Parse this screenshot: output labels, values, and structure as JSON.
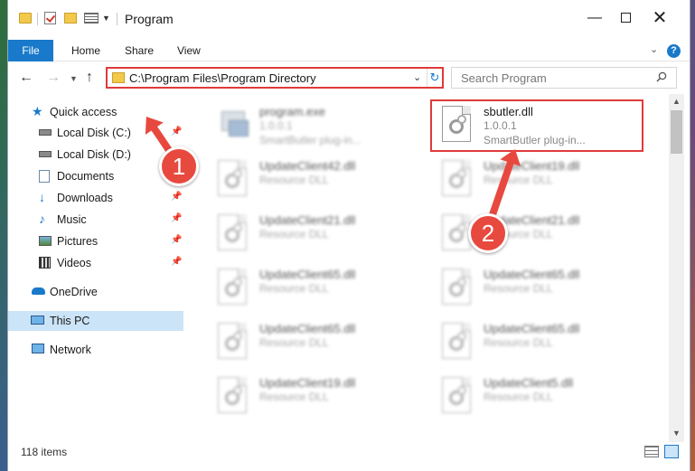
{
  "window": {
    "title": "Program",
    "minimize_glyph": "—",
    "close_glyph": "✕"
  },
  "ribbon": {
    "tabs": [
      "File",
      "Home",
      "Share",
      "View"
    ],
    "help_label": "?"
  },
  "navigation": {
    "address": "C:\\Program Files\\Program Directory",
    "search_placeholder": "Search Program"
  },
  "sidebar": {
    "items": [
      {
        "label": "Quick access",
        "icon": "star-icon"
      },
      {
        "label": "Local Disk (C:)",
        "icon": "drive-icon"
      },
      {
        "label": "Local Disk (D:)",
        "icon": "drive-icon"
      },
      {
        "label": "Documents",
        "icon": "documents-icon"
      },
      {
        "label": "Downloads",
        "icon": "download-icon"
      },
      {
        "label": "Music",
        "icon": "music-icon"
      },
      {
        "label": "Pictures",
        "icon": "pictures-icon"
      },
      {
        "label": "Videos",
        "icon": "videos-icon"
      },
      {
        "label": "OneDrive",
        "icon": "cloud-icon"
      },
      {
        "label": "This PC",
        "icon": "computer-icon"
      },
      {
        "label": "Network",
        "icon": "network-icon"
      }
    ]
  },
  "files": [
    {
      "name": "program.exe",
      "line2": "1.0.0.1",
      "line3": "SmartButler plug-in..."
    },
    {
      "name": "sbutler.dll",
      "line2": "1.0.0.1",
      "line3": "SmartButler plug-in..."
    },
    {
      "name": "UpdateClient42.dll",
      "line2": "Resource DLL"
    },
    {
      "name": "UpdateClient19.dll",
      "line2": "Resource DLL"
    },
    {
      "name": "UpdateClient21.dll",
      "line2": "Resource DLL"
    },
    {
      "name": "UpdateClient21.dll",
      "line2": "Resource DLL"
    },
    {
      "name": "UpdateClient65.dll",
      "line2": "Resource DLL"
    },
    {
      "name": "UpdateClient65.dll",
      "line2": "Resource DLL"
    },
    {
      "name": "UpdateClient65.dll",
      "line2": "Resource DLL"
    },
    {
      "name": "UpdateClient65.dll",
      "line2": "Resource DLL"
    },
    {
      "name": "UpdateClient19.dll",
      "line2": "Resource DLL"
    },
    {
      "name": "UpdateClient5.dll",
      "line2": "Resource DLL"
    }
  ],
  "status": {
    "item_count": "118 items"
  },
  "callouts": [
    "1",
    "2"
  ],
  "colors": {
    "accent": "#1979ca",
    "highlight": "#e03a3a",
    "callout": "#e8493f",
    "selected": "#cce4f7"
  }
}
